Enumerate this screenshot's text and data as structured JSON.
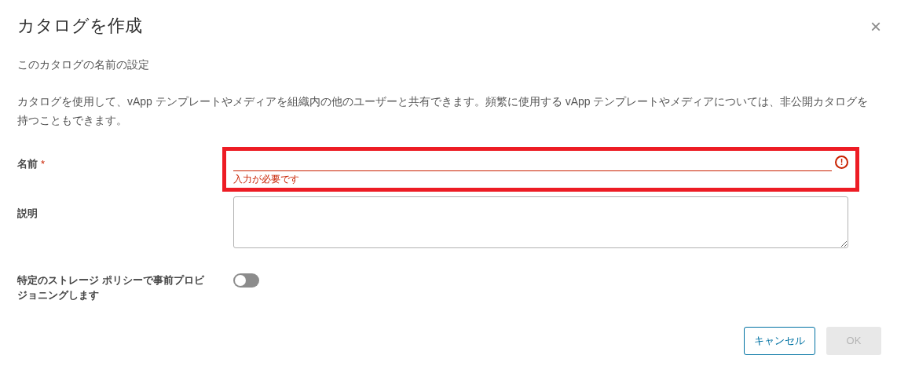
{
  "dialog": {
    "title": "カタログを作成",
    "close": "×",
    "subtitle": "このカタログの名前の設定",
    "description": "カタログを使用して、vApp テンプレートやメディアを組織内の他のユーザーと共有できます。頻繁に使用する vApp テンプレートやメディアについては、非公開カタログを持つこともできます。"
  },
  "fields": [
    {
      "kind": "text",
      "label": "名前",
      "required_mark": "*",
      "invalid": true,
      "highlighted": true,
      "error": "入力が必要です",
      "error_icon": "!"
    },
    {
      "kind": "textarea",
      "label": "説明",
      "invalid": false,
      "highlighted": false
    }
  ],
  "toggle": {
    "label": "特定のストレージ ポリシーで事前プロビジョニングします",
    "on": false
  },
  "buttons": [
    {
      "label": "キャンセル",
      "kind": "outline",
      "disabled": false
    },
    {
      "label": "OK",
      "kind": "primary",
      "disabled": true
    }
  ]
}
